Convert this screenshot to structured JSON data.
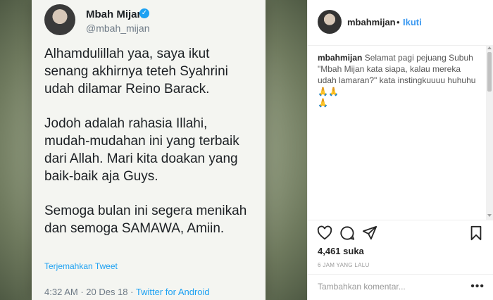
{
  "tweet": {
    "display_name": "Mbah Mijan",
    "verified_glyph": "✓",
    "handle": "@mbah_mijan",
    "paragraphs": [
      "Alhamdulillah yaa, saya ikut\nsenang akhirnya teteh Syahrini\nudah dilamar Reino Barack.",
      "Jodoh adalah rahasia Illahi,\nmudah-mudahan ini yang terbaik\ndari Allah. Mari kita doakan yang\nbaik-baik aja Guys.",
      "Semoga bulan ini segera menikah\ndan semoga SAMAWA, Amiin."
    ],
    "translate": "Terjemahkan Tweet",
    "time": "4:32 AM",
    "separator1": " · ",
    "date": "20 Des 18",
    "separator2": " · ",
    "source": "Twitter for Android"
  },
  "header": {
    "username": "mbahmijan",
    "dot": "•",
    "follow": "Ikuti"
  },
  "caption": {
    "username": "mbahmijan",
    "text": " Selamat pagi pejuang Subuh \"Mbah Mijan kata siapa, kalau mereka udah lamaran?\" kata instingkuuuu huhuhu 🙏🙏",
    "extra": "🙏"
  },
  "likes": "4,461 suka",
  "timestamp": "6 JAM YANG LALU",
  "comment_placeholder": "Tambahkan komentar...",
  "more": "•••",
  "icons": [
    "heart-icon",
    "comment-icon",
    "share-icon",
    "bookmark-icon"
  ]
}
